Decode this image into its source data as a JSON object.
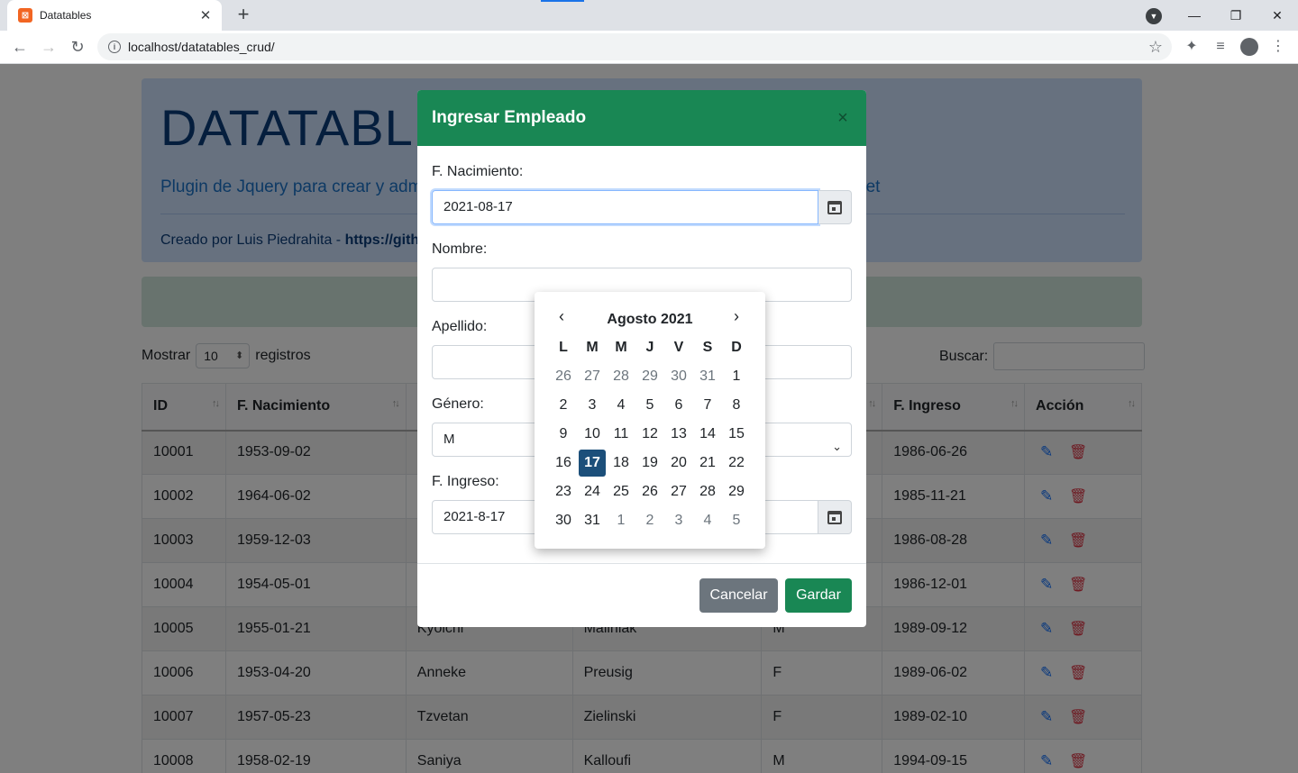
{
  "browser": {
    "tab_title": "Datatables",
    "url": "localhost/datatables_crud/"
  },
  "jumbotron": {
    "title": "DATATABLES",
    "lead": "Plugin de Jquery para crear y adm",
    "lead_tail": "net",
    "credit_prefix": "Creado por Luis Piedrahita - ",
    "credit_link": "https://gith"
  },
  "table_controls": {
    "show_label": "Mostrar",
    "show_value": "10",
    "records_label": "registros",
    "search_label": "Buscar:"
  },
  "table": {
    "headers": [
      "ID",
      "F. Nacimiento",
      "",
      "",
      "",
      "F. Ingreso",
      "Acción"
    ],
    "rows": [
      [
        "10001",
        "1953-09-02",
        "",
        "",
        "",
        "1986-06-26"
      ],
      [
        "10002",
        "1964-06-02",
        "",
        "",
        "",
        "1985-11-21"
      ],
      [
        "10003",
        "1959-12-03",
        "",
        "",
        "",
        "1986-08-28"
      ],
      [
        "10004",
        "1954-05-01",
        "",
        "",
        "",
        "1986-12-01"
      ],
      [
        "10005",
        "1955-01-21",
        "Kyoichi",
        "Maliniak",
        "M",
        "1989-09-12"
      ],
      [
        "10006",
        "1953-04-20",
        "Anneke",
        "Preusig",
        "F",
        "1989-06-02"
      ],
      [
        "10007",
        "1957-05-23",
        "Tzvetan",
        "Zielinski",
        "F",
        "1989-02-10"
      ],
      [
        "10008",
        "1958-02-19",
        "Saniya",
        "Kalloufi",
        "M",
        "1994-09-15"
      ]
    ]
  },
  "modal": {
    "title": "Ingresar Empleado",
    "close": "×",
    "fnac_label": "F. Nacimiento:",
    "fnac_value": "2021-08-17",
    "nombre_label": "Nombre:",
    "apellido_label": "Apellido:",
    "genero_label": "Género:",
    "genero_value": "M",
    "fingreso_label": "F. Ingreso:",
    "fingreso_value": "2021-8-17",
    "cancel_label": "Cancelar",
    "save_label": "Gardar"
  },
  "datepicker": {
    "title": "Agosto 2021",
    "prev": "‹",
    "next": "›",
    "weekdays": [
      "L",
      "M",
      "M",
      "J",
      "V",
      "S",
      "D"
    ],
    "weeks": [
      [
        {
          "d": "26",
          "o": true
        },
        {
          "d": "27",
          "o": true
        },
        {
          "d": "28",
          "o": true
        },
        {
          "d": "29",
          "o": true
        },
        {
          "d": "30",
          "o": true
        },
        {
          "d": "31",
          "o": true
        },
        {
          "d": "1"
        }
      ],
      [
        {
          "d": "2"
        },
        {
          "d": "3"
        },
        {
          "d": "4"
        },
        {
          "d": "5"
        },
        {
          "d": "6"
        },
        {
          "d": "7"
        },
        {
          "d": "8"
        }
      ],
      [
        {
          "d": "9"
        },
        {
          "d": "10"
        },
        {
          "d": "11"
        },
        {
          "d": "12"
        },
        {
          "d": "13"
        },
        {
          "d": "14"
        },
        {
          "d": "15"
        }
      ],
      [
        {
          "d": "16"
        },
        {
          "d": "17",
          "a": true
        },
        {
          "d": "18"
        },
        {
          "d": "19"
        },
        {
          "d": "20"
        },
        {
          "d": "21"
        },
        {
          "d": "22"
        }
      ],
      [
        {
          "d": "23"
        },
        {
          "d": "24"
        },
        {
          "d": "25"
        },
        {
          "d": "26"
        },
        {
          "d": "27"
        },
        {
          "d": "28"
        },
        {
          "d": "29"
        }
      ],
      [
        {
          "d": "30"
        },
        {
          "d": "31"
        },
        {
          "d": "1",
          "o": true
        },
        {
          "d": "2",
          "o": true
        },
        {
          "d": "3",
          "o": true
        },
        {
          "d": "4",
          "o": true
        },
        {
          "d": "5",
          "o": true
        }
      ]
    ]
  },
  "colors": {
    "modal_header": "#198754",
    "active_day": "#1c4f7a",
    "edit_icon": "#0d6efd",
    "delete_icon": "#dc3545"
  }
}
